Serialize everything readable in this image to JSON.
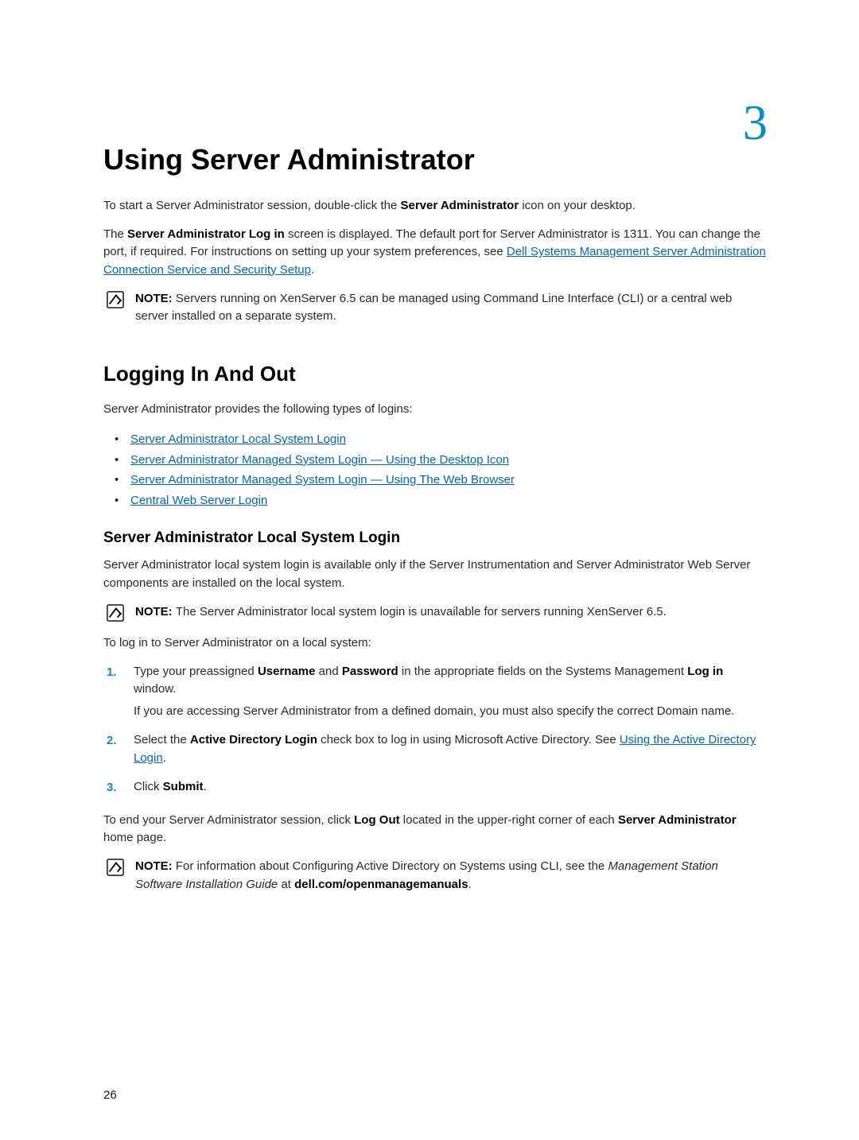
{
  "chapter_number": "3",
  "title": "Using Server Administrator",
  "intro_p1_pre": "To start a Server Administrator session, double-click the ",
  "intro_p1_bold": "Server Administrator",
  "intro_p1_post": " icon on your desktop.",
  "intro_p2_pre": "The ",
  "intro_p2_b1": "Server Administrator Log in",
  "intro_p2_mid": " screen is displayed. The default port for Server Administrator is 1311. You can change the port, if required. For instructions on setting up your system preferences, see ",
  "intro_p2_link": "Dell Systems Management Server Administration Connection Service and Security Setup",
  "intro_p2_post": ".",
  "note1_label": "NOTE: ",
  "note1_text": "Servers running on XenServer 6.5 can be managed using Command Line Interface (CLI) or a central web server installed on a separate system.",
  "section2_title": "Logging In And Out",
  "section2_intro": "Server Administrator provides the following types of logins:",
  "login_types": [
    "Server Administrator Local System Login",
    "Server Administrator Managed System Login — Using the Desktop Icon",
    "Server Administrator Managed System Login — Using The Web Browser",
    "Central Web Server Login"
  ],
  "section3_title": "Server Administrator Local System Login",
  "section3_p1": "Server Administrator local system login is available only if the Server Instrumentation and Server Administrator Web Server components are installed on the local system.",
  "note2_label": "NOTE: ",
  "note2_text": "The Server Administrator local system login is unavailable for servers running XenServer 6.5.",
  "section3_p2": "To log in to Server Administrator on a local system:",
  "steps": [
    {
      "num": "1.",
      "line1_pre": "Type your preassigned ",
      "line1_b1": "Username",
      "line1_mid1": " and ",
      "line1_b2": "Password",
      "line1_mid2": " in the appropriate fields on the Systems Management ",
      "line1_b3": "Log in",
      "line1_post": " window.",
      "line2": "If you are accessing Server Administrator from a defined domain, you must also specify the correct Domain name."
    },
    {
      "num": "2.",
      "line1_pre": "Select the ",
      "line1_b1": "Active Directory Login",
      "line1_mid1": " check box to log in using Microsoft Active Directory. See ",
      "line1_link": "Using the Active Directory Login",
      "line1_post": "."
    },
    {
      "num": "3.",
      "line1_pre": "Click ",
      "line1_b1": "Submit",
      "line1_post": "."
    }
  ],
  "end_p_pre": "To end your Server Administrator session, click ",
  "end_p_b1": "Log Out",
  "end_p_mid": " located in the upper-right corner of each ",
  "end_p_b2": "Server Administrator",
  "end_p_post": " home page.",
  "note3_label": "NOTE: ",
  "note3_text_pre": "For information about Configuring Active Directory on Systems using CLI, see the ",
  "note3_italic": "Management Station Software Installation Guide",
  "note3_text_mid": " at ",
  "note3_bold": "dell.com/openmanagemanuals",
  "note3_text_post": ".",
  "page_number": "26"
}
